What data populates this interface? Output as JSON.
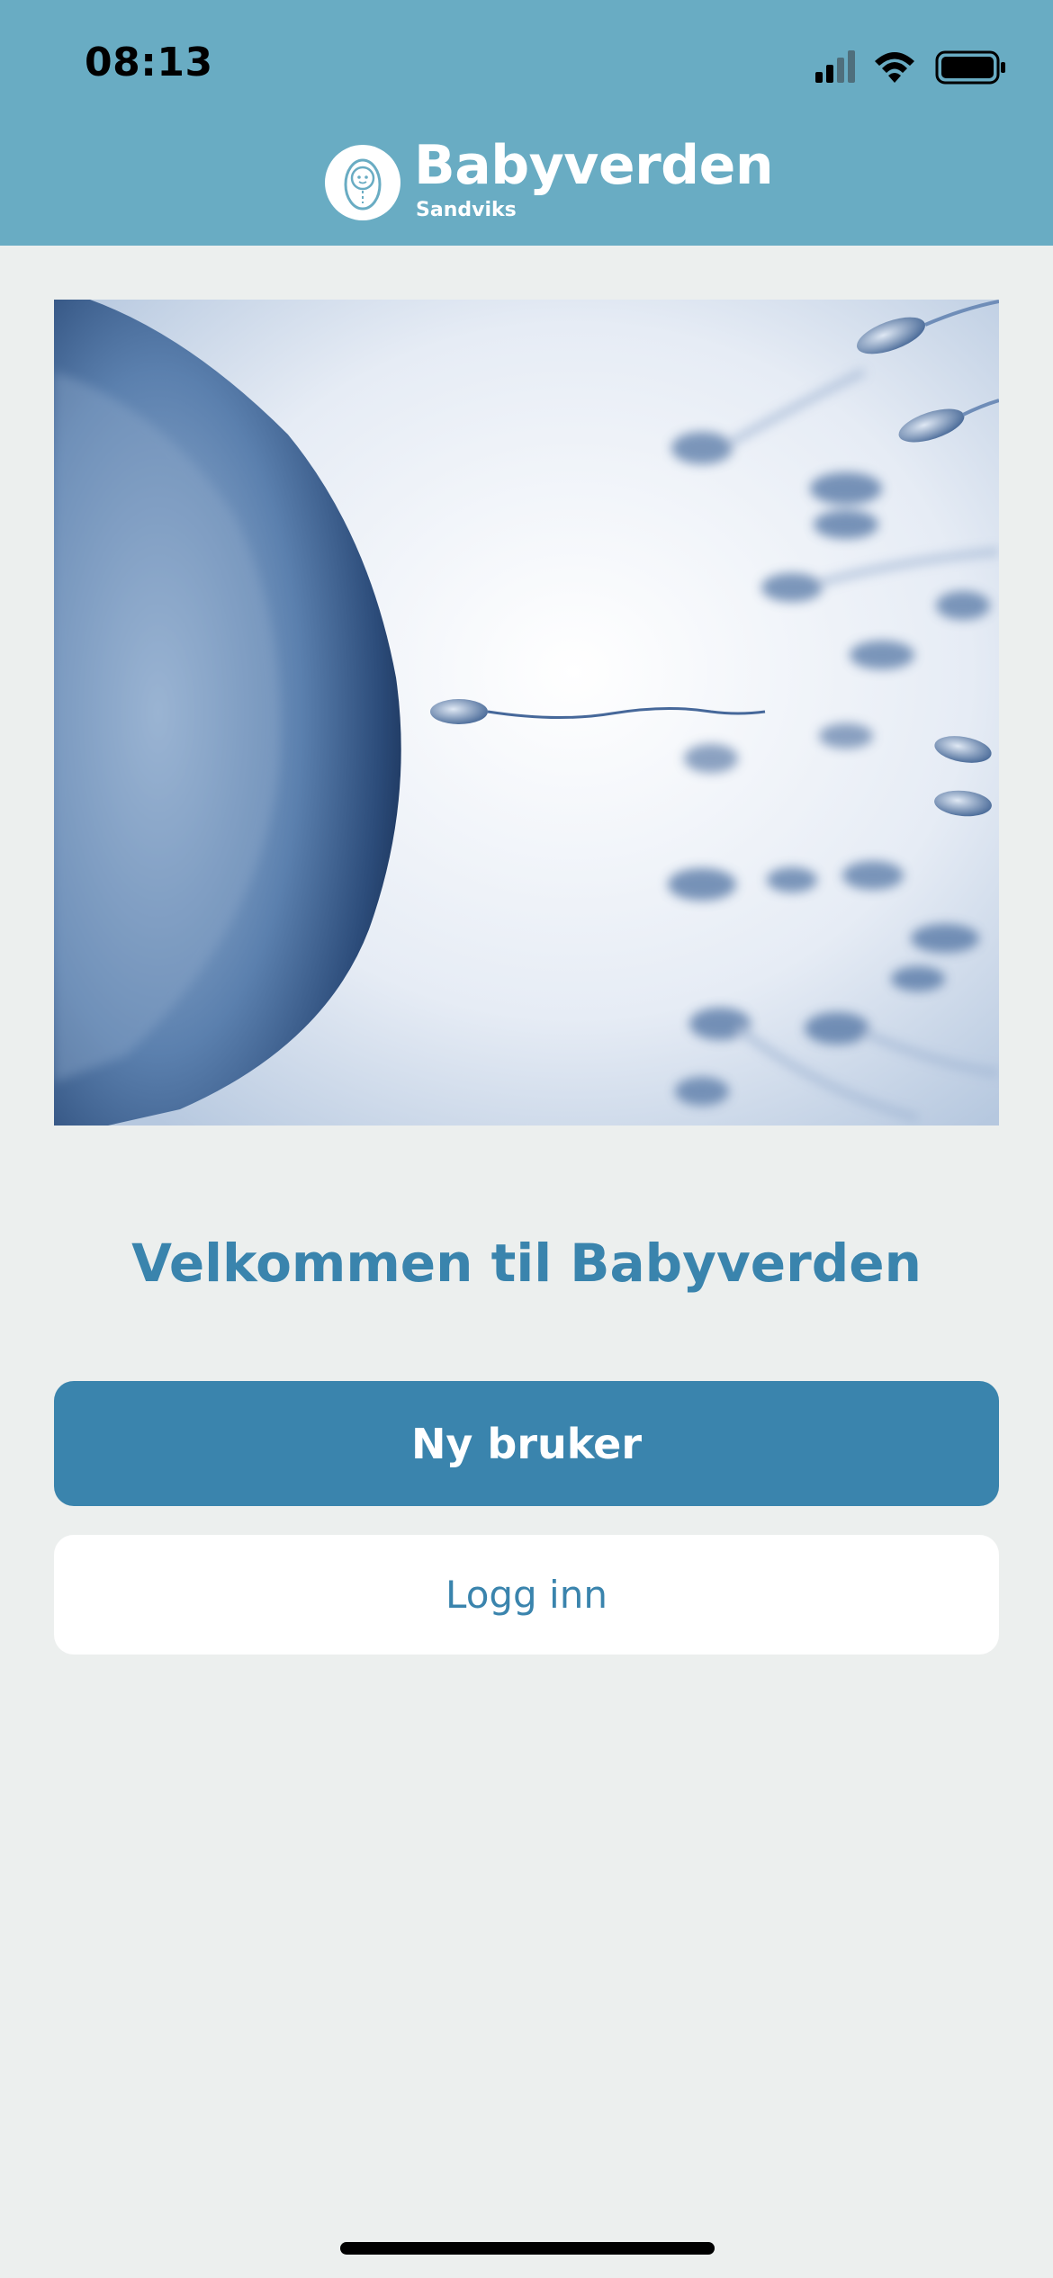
{
  "status_bar": {
    "time": "08:13",
    "icons": [
      "cellular-signal-icon",
      "wifi-icon",
      "battery-icon"
    ]
  },
  "header": {
    "brand_name": "Babyverden",
    "brand_subtitle": "Sandviks",
    "logo_icon": "baby-icon"
  },
  "hero": {
    "icon": "hero-image"
  },
  "welcome_title": "Velkommen til Babyverden",
  "buttons": {
    "new_user_label": "Ny bruker",
    "login_label": "Logg inn"
  },
  "colors": {
    "header_bg": "#69acc3",
    "accent": "#3a84ad",
    "page_bg": "#ecefee"
  }
}
